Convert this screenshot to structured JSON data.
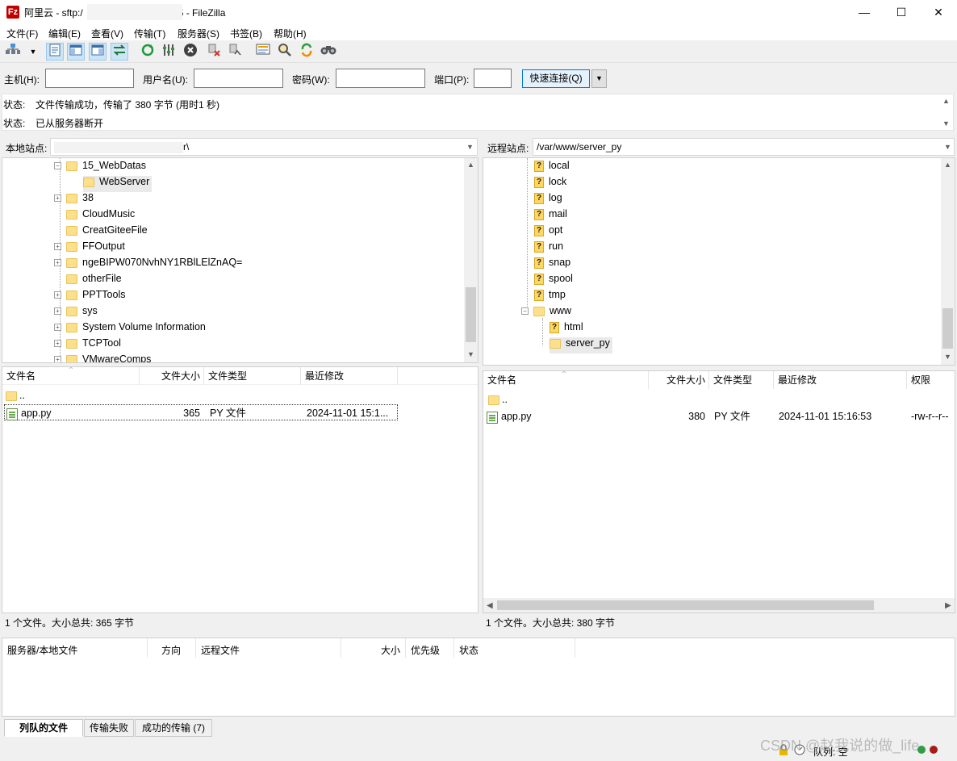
{
  "window": {
    "title_prefix": "阿里云 - sftp:/",
    "title_suffix": "5 - FileZilla",
    "app_icon_glyph": "Fz",
    "minimize": "—",
    "maximize": "☐",
    "close": "✕"
  },
  "menu": [
    "文件(F)",
    "编辑(E)",
    "查看(V)",
    "传输(T)",
    "服务器(S)",
    "书签(B)",
    "帮助(H)"
  ],
  "toolbar": {
    "icons": [
      "site-manager-icon",
      "dropdown-arrow-icon",
      "message-log-icon",
      "local-tree-icon",
      "remote-tree-icon",
      "transfer-queue-icon",
      "refresh-icon",
      "process-queue-icon",
      "cancel-icon",
      "disconnect-icon",
      "reconnect-icon",
      "directory-listing-filter-icon",
      "toggle-comparison-icon",
      "sync-browsing-icon",
      "search-icon"
    ]
  },
  "quickconnect": {
    "host_label": "主机(H):",
    "user_label": "用户名(U):",
    "password_label": "密码(W):",
    "port_label": "端口(P):",
    "host_value": "",
    "user_value": "",
    "password_value": "",
    "port_value": "",
    "button": "快速连接(Q)",
    "dropdown": "▼"
  },
  "log": [
    {
      "label": "状态:",
      "text": "文件传输成功，传输了 380 字节 (用时1 秒)"
    },
    {
      "label": "状态:",
      "text": "已从服务器断开"
    }
  ],
  "local": {
    "site_label": "本地站点:",
    "site_path": "r\\",
    "tree": [
      {
        "name": "15_WebDatas",
        "expander": "−"
      },
      {
        "name": "WebServer",
        "expander": ""
      },
      {
        "name": "38",
        "expander": "+"
      },
      {
        "name": "CloudMusic",
        "expander": ""
      },
      {
        "name": "CreatGiteeFile",
        "expander": ""
      },
      {
        "name": "FFOutput",
        "expander": "+"
      },
      {
        "name": "ngeBIPW070NvhNY1RBlLElZnAQ=",
        "expander": "+"
      },
      {
        "name": "otherFile",
        "expander": ""
      },
      {
        "name": "PPTTools",
        "expander": "+"
      },
      {
        "name": "sys",
        "expander": "+"
      },
      {
        "name": "System Volume Information",
        "expander": "+"
      },
      {
        "name": "TCPTool",
        "expander": "+"
      },
      {
        "name": "VMwareComps",
        "expander": "+"
      }
    ],
    "columns": [
      "文件名",
      "文件大小",
      "文件类型",
      "最近修改"
    ],
    "files": [
      {
        "name": "..",
        "size": "",
        "type": "",
        "modified": ""
      },
      {
        "name": "app.py",
        "size": "365",
        "type": "PY 文件",
        "modified": "2024-11-01 15:1..."
      }
    ],
    "status": "1 个文件。大小总共: 365 字节"
  },
  "remote": {
    "site_label": "远程站点:",
    "site_path": "/var/www/server_py",
    "tree": [
      {
        "name": "local",
        "kind": "unknown"
      },
      {
        "name": "lock",
        "kind": "unknown"
      },
      {
        "name": "log",
        "kind": "unknown"
      },
      {
        "name": "mail",
        "kind": "unknown"
      },
      {
        "name": "opt",
        "kind": "unknown"
      },
      {
        "name": "run",
        "kind": "unknown"
      },
      {
        "name": "snap",
        "kind": "unknown"
      },
      {
        "name": "spool",
        "kind": "unknown"
      },
      {
        "name": "tmp",
        "kind": "unknown"
      },
      {
        "name": "www",
        "kind": "open"
      },
      {
        "name": "html",
        "kind": "unknown"
      },
      {
        "name": "server_py",
        "kind": "folder"
      }
    ],
    "columns": [
      "文件名",
      "文件大小",
      "文件类型",
      "最近修改",
      "权限"
    ],
    "files": [
      {
        "name": "..",
        "size": "",
        "type": "",
        "modified": "",
        "perm": ""
      },
      {
        "name": "app.py",
        "size": "380",
        "type": "PY 文件",
        "modified": "2024-11-01 15:16:53",
        "perm": "-rw-r--r--"
      }
    ],
    "status": "1 个文件。大小总共: 380 字节"
  },
  "queue": {
    "columns": [
      "服务器/本地文件",
      "方向",
      "远程文件",
      "大小",
      "优先级",
      "状态"
    ],
    "tabs": [
      "列队的文件",
      "传输失败",
      "成功的传输 (7)"
    ],
    "status": "队列: 空"
  },
  "watermark": "CSDN @赵我说的做_life"
}
